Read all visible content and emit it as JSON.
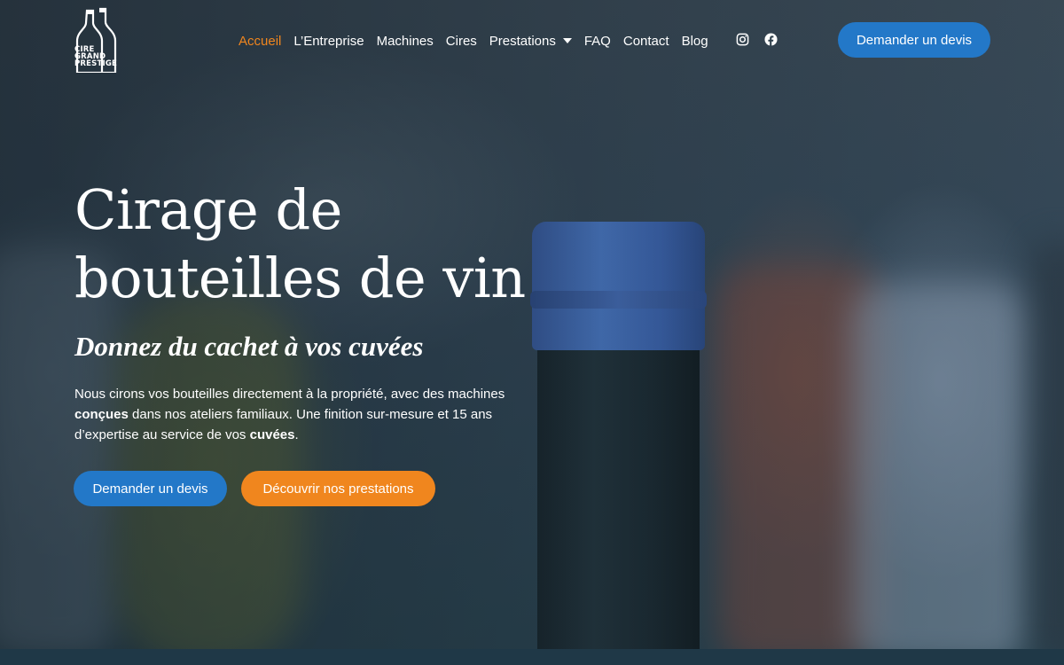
{
  "colors": {
    "accent": "#f0861e",
    "primary": "#2378c8",
    "text": "#ffffff"
  },
  "logo": {
    "lines": [
      "CIRE",
      "GRAND",
      "PRESTIGE"
    ]
  },
  "nav": {
    "items": [
      {
        "label": "Accueil",
        "active": true
      },
      {
        "label": "L’Entreprise"
      },
      {
        "label": "Machines"
      },
      {
        "label": "Cires"
      },
      {
        "label": "Prestations",
        "has_dropdown": true
      },
      {
        "label": "FAQ"
      },
      {
        "label": "Contact"
      },
      {
        "label": "Blog"
      }
    ],
    "social": [
      "instagram-icon",
      "facebook-icon"
    ],
    "cta_label": "Demander un devis"
  },
  "hero": {
    "title_line1": "Cirage de",
    "title_line2": "bouteilles de vin",
    "subtitle": "Donnez du cachet à vos cuvées",
    "desc_part1": "Nous cirons vos bouteilles directement à la propriété, avec des machines ",
    "desc_bold1": "conçues",
    "desc_part2": " dans nos ateliers familiaux. Une finition sur-mesure et 15 ans d’expertise au service de vos ",
    "desc_bold2": "cuvées",
    "desc_part3": ".",
    "primary_button": "Demander un devis",
    "secondary_button": "Découvrir nos prestations"
  }
}
